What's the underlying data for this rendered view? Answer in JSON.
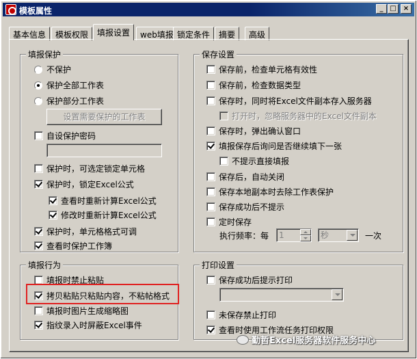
{
  "window": {
    "title": "模板属性",
    "min_glyph": "_",
    "max_glyph": "□",
    "close_glyph": "×"
  },
  "tabs": [
    {
      "label": "基本信息",
      "active": false
    },
    {
      "label": "模板权限",
      "active": false
    },
    {
      "label": "填报设置",
      "active": true
    },
    {
      "label": "web填报",
      "active": false
    },
    {
      "label": "锁定条件",
      "active": false
    },
    {
      "label": "摘要",
      "active": false
    },
    {
      "label": "高级",
      "active": false
    }
  ],
  "protect": {
    "title": "填报保护",
    "radio_none": "不保护",
    "radio_all": "保护全部工作表",
    "radio_part": "保护部分工作表",
    "set_sheets_button": "设置需要保护的工作表",
    "custom_password": "自设保护密码",
    "password_value": "",
    "select_locked_cells": "保护时，可选定锁定单元格",
    "lock_excel_formula": "保护时，锁定Excel公式",
    "recalc_on_view": "查看时重新计算Excel公式",
    "recalc_on_edit": "修改时重新计算Excel公式",
    "cell_format_adjustable": "保护时，单元格格式可调",
    "protect_on_view": "查看时保护工作簿"
  },
  "save": {
    "title": "保存设置",
    "check_cell_validity": "保存前，检查单元格有效性",
    "check_data_type": "保存前，检查数据类型",
    "store_excel_copy": "保存时，同时将Excel文件副本存入服务器",
    "ignore_server_copy": "打开时，忽略服务器中的Excel文件副本",
    "confirm_window": "保存时，弹出确认窗口",
    "ask_continue": "填报保存后询问是否继续填下一张",
    "no_prompt_fill": "不提示直接填报",
    "auto_close": "保存后，自动关闭",
    "remove_sheet_protect": "保存本地副本时去除工作表保护",
    "no_prompt_success": "保存成功后不提示",
    "timed_save": "定时保存",
    "frequency_label": "执行频率：每",
    "frequency_value": "1",
    "frequency_unit": "秒",
    "once": "一次"
  },
  "behavior": {
    "title": "填报行为",
    "no_paste": "填报时禁止粘贴",
    "paste_content_only": "拷贝粘贴只粘贴内容，不粘帖格式",
    "thumbnail": "填报时图片生成缩略图",
    "mask_excel_events": "指纹录入时屏蔽Excel事件"
  },
  "print": {
    "title": "打印设置",
    "prompt_print_after_save": "保存成功后提示打印",
    "printer_value": "",
    "no_print_unsaved": "未保存禁止打印",
    "workflow_print_permission": "查看时使用工作流任务打印权限"
  },
  "watermark": "勤哲Excel服务器软件服务中心",
  "colors": {
    "titlebar": "#0a246a",
    "face": "#d4d0c8",
    "highlight_box": "#e02020"
  }
}
